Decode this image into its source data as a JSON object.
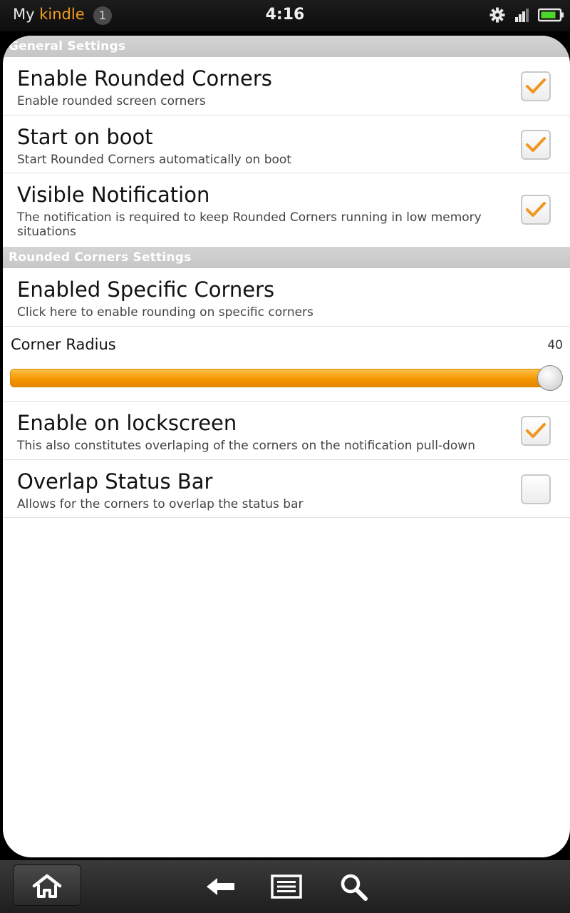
{
  "status_bar": {
    "brand_prefix": "My",
    "brand_name": "kindle",
    "notification_count": "1",
    "time": "4:16",
    "icons": [
      "gear-icon",
      "signal-icon",
      "battery-icon"
    ]
  },
  "colors": {
    "accent": "#f49b1c",
    "section_header_bg": "#cccccc",
    "checkmark": "#f0961e"
  },
  "sections": {
    "general": "General Settings",
    "rounded": "Rounded Corners Settings"
  },
  "prefs": {
    "rounded_corners": {
      "title": "Enable Rounded Corners",
      "summary": "Enable rounded screen corners",
      "checked": true
    },
    "start_on_boot": {
      "title": "Start on boot",
      "summary": "Start Rounded Corners automatically on boot",
      "checked": true
    },
    "visible_notification": {
      "title": "Visible Notification",
      "summary": "The notification is required to keep Rounded Corners running in low memory situations",
      "checked": true
    },
    "specific_corners": {
      "title": "Enabled Specific Corners",
      "summary": "Click here to enable rounding on specific corners"
    },
    "corner_radius": {
      "label": "Corner Radius",
      "value": "40",
      "fraction": 1.0
    },
    "lockscreen": {
      "title": "Enable on lockscreen",
      "summary": "This also constitutes overlaping of the corners on the notification pull-down",
      "checked": true
    },
    "overlap_status_bar": {
      "title": "Overlap Status Bar",
      "summary": "Allows for the corners to overlap the status bar",
      "checked": false
    }
  },
  "nav": {
    "buttons": [
      "home-icon",
      "back-icon",
      "menu-icon",
      "search-icon"
    ]
  }
}
